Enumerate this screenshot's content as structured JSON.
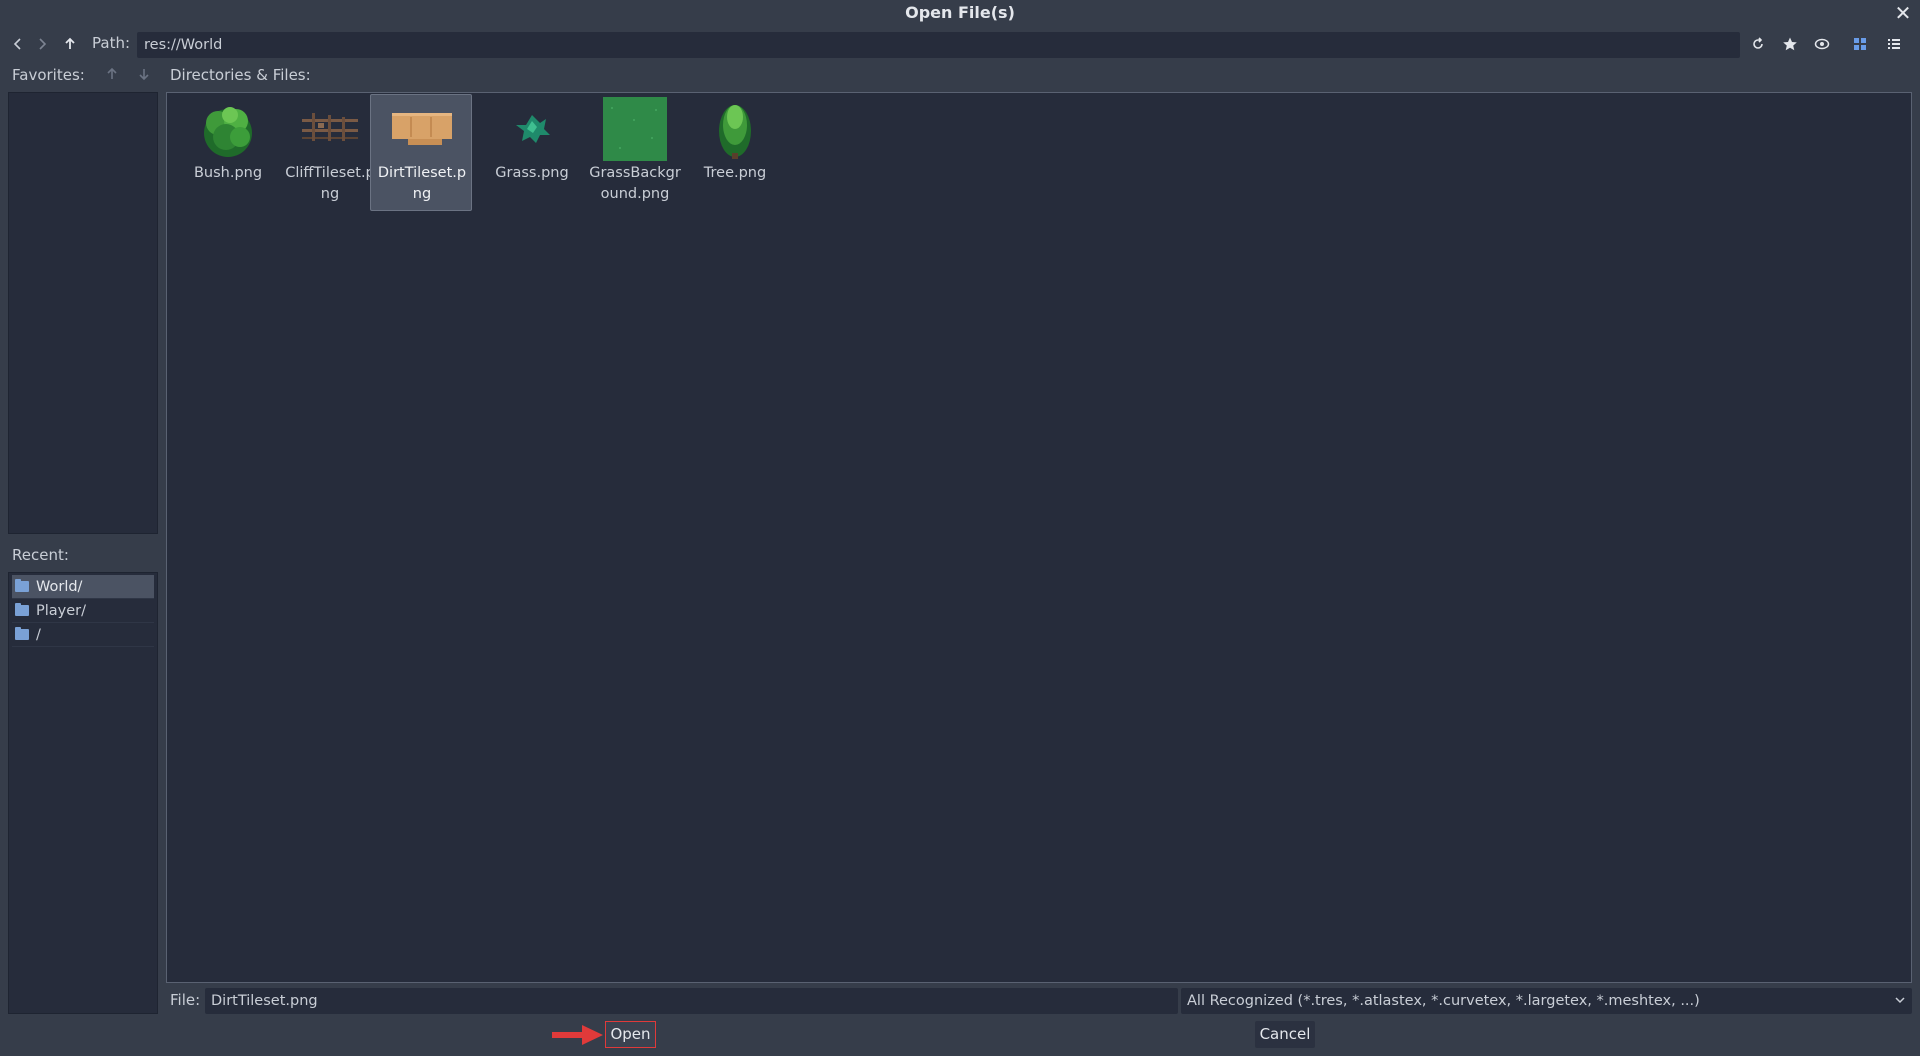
{
  "window": {
    "title": "Open File(s)",
    "close_glyph": "✕"
  },
  "toolbar": {
    "back_icon": "chevron-left-icon",
    "forward_icon": "chevron-right-icon",
    "up_icon": "arrow-up-icon",
    "path_label": "Path:",
    "path_value": "res://World",
    "refresh_icon": "reload-icon",
    "favorite_icon": "star-icon",
    "hidden_icon": "eye-icon",
    "grid_view_icon": "grid-view-icon",
    "list_view_icon": "list-view-icon"
  },
  "favorites": {
    "label": "Favorites:",
    "items": []
  },
  "directories": {
    "label": "Directories & Files:"
  },
  "recent": {
    "label": "Recent:",
    "items": [
      {
        "label": "World/",
        "selected": true
      },
      {
        "label": "Player/",
        "selected": false
      },
      {
        "label": "/",
        "selected": false
      }
    ]
  },
  "files": [
    {
      "name": "Bush.png",
      "selected": false
    },
    {
      "name": "CliffTileset.png",
      "selected": false
    },
    {
      "name": "DirtTileset.png",
      "selected": true
    },
    {
      "name": "Grass.png",
      "selected": false
    },
    {
      "name": "GrassBackground.png",
      "selected": false
    },
    {
      "name": "Tree.png",
      "selected": false
    }
  ],
  "bottom": {
    "file_label": "File:",
    "file_value": "DirtTileset.png",
    "filter_value": "All Recognized (*.tres, *.atlastex, *.curvetex, *.largetex, *.meshtex, ...)",
    "open_label": "Open",
    "cancel_label": "Cancel"
  },
  "colors": {
    "background": "#363d4a",
    "panel": "#262c3b",
    "selection": "#4b5363",
    "accent": "#699ce8",
    "highlight_box": "#e03a3a"
  }
}
